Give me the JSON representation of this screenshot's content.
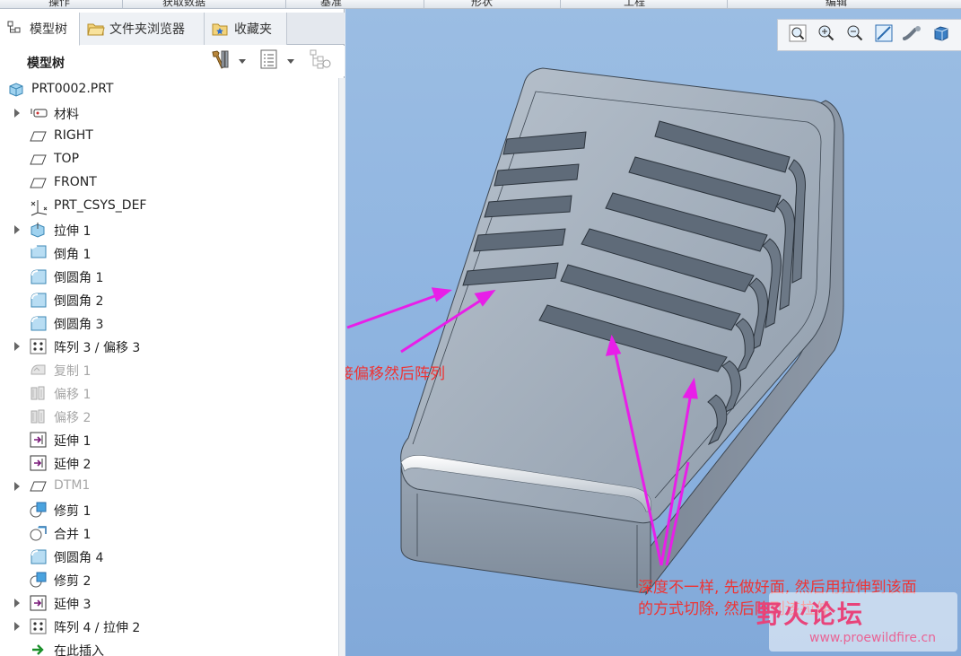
{
  "menubar": {
    "items": [
      "操作",
      "获取数据",
      "基准",
      "形状",
      "工程",
      "编辑"
    ]
  },
  "tabs": [
    {
      "label": "模型树",
      "icon": "model-tree-icon"
    },
    {
      "label": "文件夹浏览器",
      "icon": "folder-browser-icon"
    },
    {
      "label": "收藏夹",
      "icon": "favorites-icon"
    }
  ],
  "tree_header": {
    "title": "模型树"
  },
  "tree": {
    "root": "PRT0002.PRT",
    "items": [
      {
        "label": "材料",
        "icon": "material-icon",
        "expandable": true,
        "dim": false
      },
      {
        "label": "RIGHT",
        "icon": "datum-plane-icon",
        "expandable": false,
        "dim": false
      },
      {
        "label": "TOP",
        "icon": "datum-plane-icon",
        "expandable": false,
        "dim": false
      },
      {
        "label": "FRONT",
        "icon": "datum-plane-icon",
        "expandable": false,
        "dim": false
      },
      {
        "label": "PRT_CSYS_DEF",
        "icon": "csys-icon",
        "expandable": false,
        "dim": false
      },
      {
        "label": "拉伸 1",
        "icon": "extrude-icon",
        "expandable": true,
        "dim": false
      },
      {
        "label": "倒角 1",
        "icon": "chamfer-icon",
        "expandable": false,
        "dim": false
      },
      {
        "label": "倒圆角 1",
        "icon": "round-icon",
        "expandable": false,
        "dim": false
      },
      {
        "label": "倒圆角 2",
        "icon": "round-icon",
        "expandable": false,
        "dim": false
      },
      {
        "label": "倒圆角 3",
        "icon": "round-icon",
        "expandable": false,
        "dim": false
      },
      {
        "label": "阵列 3 / 偏移 3",
        "icon": "pattern-icon",
        "expandable": true,
        "dim": false
      },
      {
        "label": "复制 1",
        "icon": "copy-icon",
        "expandable": false,
        "dim": true
      },
      {
        "label": "偏移 1",
        "icon": "offset-icon",
        "expandable": false,
        "dim": true
      },
      {
        "label": "偏移 2",
        "icon": "offset-icon",
        "expandable": false,
        "dim": true
      },
      {
        "label": "延伸 1",
        "icon": "extend-icon",
        "expandable": false,
        "dim": false
      },
      {
        "label": "延伸 2",
        "icon": "extend-icon",
        "expandable": false,
        "dim": false
      },
      {
        "label": "DTM1",
        "icon": "datum-plane-icon",
        "expandable": true,
        "dim": true
      },
      {
        "label": "修剪 1",
        "icon": "trim-icon",
        "expandable": false,
        "dim": false
      },
      {
        "label": "合并 1",
        "icon": "merge-icon",
        "expandable": false,
        "dim": false
      },
      {
        "label": "倒圆角 4",
        "icon": "round-icon",
        "expandable": false,
        "dim": false
      },
      {
        "label": "修剪 2",
        "icon": "trim-icon",
        "expandable": false,
        "dim": false
      },
      {
        "label": "延伸 3",
        "icon": "extend-icon",
        "expandable": true,
        "dim": false
      },
      {
        "label": "阵列 4 / 拉伸 2",
        "icon": "pattern-icon",
        "expandable": true,
        "dim": false
      },
      {
        "label": "在此插入",
        "icon": "insert-arrow-icon",
        "expandable": false,
        "dim": false
      }
    ]
  },
  "view_toolbar": [
    "refit-icon",
    "zoom-in-icon",
    "zoom-out-icon",
    "repaint-icon",
    "view-manager-icon",
    "display-style-icon"
  ],
  "annotations": {
    "note1": "深度一样就直接偏移然后阵列",
    "note2_line1": "深度不一样, 先做好面, 然后用拉伸到该面",
    "note2_line2": "的方式切除, 然后阵列该拉伸"
  },
  "watermark": {
    "title": "野火论坛",
    "url": "www.proewildfire.cn"
  },
  "colors": {
    "viewport_bg": "#8db3e0",
    "annotation_red": "#ee3434",
    "arrow_magenta": "#e81ee8",
    "model_gray": "#8a97a6"
  }
}
